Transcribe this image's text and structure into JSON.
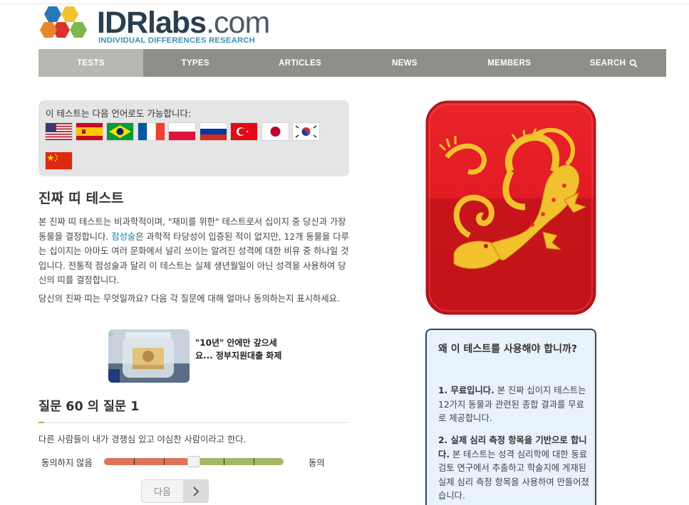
{
  "logo": {
    "brand": "IDRlabs",
    "domain_suffix": ".com",
    "tagline": "INDIVIDUAL DIFFERENCES RESEARCH",
    "hex_colors": [
      "#e8862c",
      "#f2c230",
      "#2a77b8",
      "#d9342b",
      "#7db84a"
    ]
  },
  "nav": {
    "items": [
      {
        "label": "TESTS",
        "active": true
      },
      {
        "label": "TYPES",
        "active": false
      },
      {
        "label": "ARTICLES",
        "active": false
      },
      {
        "label": "NEWS",
        "active": false
      },
      {
        "label": "MEMBERS",
        "active": false
      },
      {
        "label": "SEARCH",
        "active": false,
        "icon": "search-icon"
      }
    ]
  },
  "languages": {
    "title": "이 테스트는 다음 언어로도 가능합니다:",
    "flags": [
      "us",
      "es",
      "br",
      "fr",
      "pl",
      "ru",
      "tr",
      "jp",
      "kr",
      "cn"
    ]
  },
  "test": {
    "title": "진짜 띠 테스트",
    "intro_part1": "본 진짜 띠 테스트는 비과학적이며, \"재미를 위한\" 테스트로서 십이지 중 당신과 가장 동물을 결정합니다. ",
    "intro_link": "점성술",
    "intro_part2": "은 과학적 타당성이 입증된 적이 없지만, 12개 동물을 다루는 십이지는 아마도 여러 문화에서 널리 쓰이는 알려진 성격에 대한 비유 중 하나일 것입니다. 전통적 점성술과 달리 이 테스트는 실제 생년월일이 아닌 성격을 사용하여 당신의 띠를 결정합니다.",
    "question_prompt": "당신의 진짜 띠는 무엇일까요? 다음 각 질문에 대해 얼마나 동의하는지 표시하세요."
  },
  "ad": {
    "text": "\"10년\" 안에만 갚으세요... 정부지원대출 화제",
    "choice_label": "▷"
  },
  "question": {
    "heading": "질문 60 의 질문 1",
    "current": 1,
    "total": 60,
    "statement": "다른 사람들이 내가 경쟁심 있고 야심찬 사람이라고 한다.",
    "scale_left": "동의하지 않음",
    "scale_right": "동의",
    "slider_value": 0.5,
    "next_label": "다음"
  },
  "sidebar": {
    "image_alt": "dragon",
    "card_colors": {
      "top": "#e31b23",
      "bottom": "#c8151a",
      "dragon": "#f2c12e"
    },
    "why_title": "왜 이 테스트를 사용해야 합니까?",
    "points": [
      {
        "bold": "1. 무료입니다.",
        "text": " 본 진짜 십이지 테스트는 12가지 동물과 관련된 종합 결과를 무료로 제공합니다."
      },
      {
        "bold": "2. 실제 심리 측정 항목을 기반으로 합니다.",
        "text": " 본 테스트는 성격 심리학에 대한 동료 검토 연구에서 추출하고 학술지에 게재된 실제 심리 측정 항목을 사용하여 만들어졌습니다."
      }
    ]
  }
}
